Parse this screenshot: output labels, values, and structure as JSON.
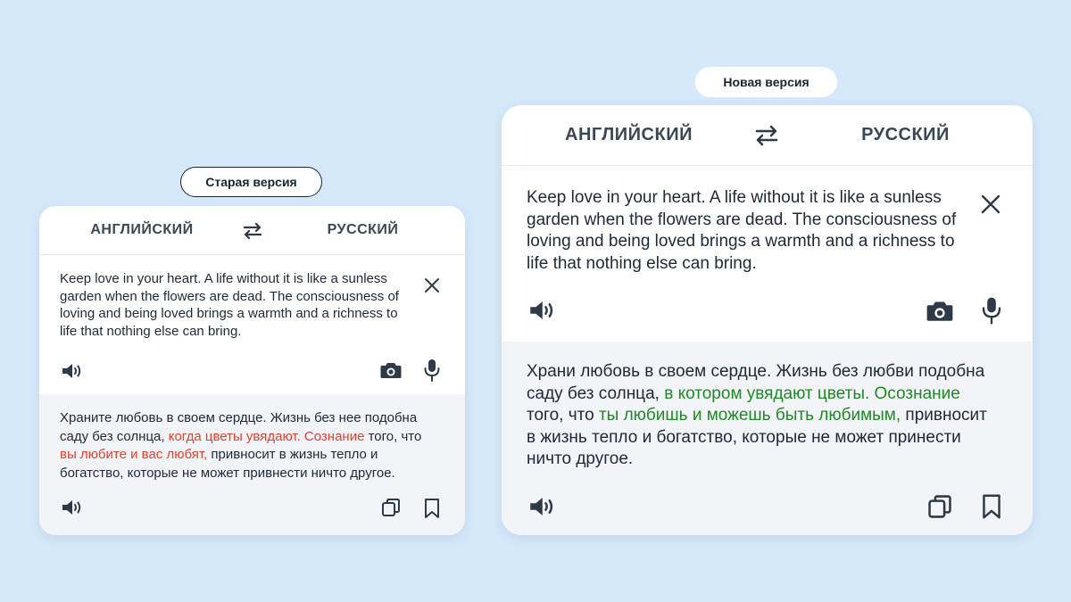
{
  "colors": {
    "background": "#d6e9fb",
    "card": "#ffffff",
    "translation_panel": "#f3f4f8",
    "old_highlight": "#e5402b",
    "new_highlight": "#1e8a23",
    "icon": "#2f3a48"
  },
  "old_version": {
    "label": "Старая версия",
    "lang_source": "АНГЛИЙСКИЙ",
    "lang_target": "РУССКИЙ",
    "source_text": "Keep love in your heart. A life without it is like a sunless garden when the flowers are dead. The consciousness of loving and being loved brings a warmth and a richness to life that nothing else can bring.",
    "translation": {
      "part1": "Храните любовь в своем сердце. Жизнь без нее подобна саду без солнца, ",
      "hl1": "когда цветы увядают. Сознание",
      "part2": " того, что ",
      "hl2": "вы любите и вас любят,",
      "part3": " привносит в жизнь тепло и богатство, которые не может привнести ничто другое."
    },
    "icons": {
      "swap": "swap-arrows-icon",
      "clear": "close-icon",
      "speak_source": "speaker-icon",
      "camera": "camera-icon",
      "microphone": "microphone-icon",
      "speak_translation": "speaker-icon",
      "copy": "copy-icon",
      "bookmark": "bookmark-icon"
    }
  },
  "new_version": {
    "label": "Новая версия",
    "lang_source": "АНГЛИЙСКИЙ",
    "lang_target": "РУССКИЙ",
    "source_text": "Keep love in your heart. A life without it is like a sunless garden when the flowers are dead. The consciousness of loving and being loved brings a warmth and a richness to life that nothing else can bring.",
    "translation": {
      "part1": "Храни любовь в своем сердце. Жизнь без любви подобна саду без солнца, ",
      "hl1": "в котором увядают цветы. Осознание",
      "part2": " того, что ",
      "hl2": "ты любишь и можешь быть любимым,",
      "part3": " привносит в жизнь тепло и богатство, которые не может принести ничто другое."
    },
    "icons": {
      "swap": "swap-arrows-icon",
      "clear": "close-icon",
      "speak_source": "speaker-icon",
      "camera": "camera-icon",
      "microphone": "microphone-icon",
      "speak_translation": "speaker-icon",
      "copy": "copy-icon",
      "bookmark": "bookmark-icon"
    }
  }
}
